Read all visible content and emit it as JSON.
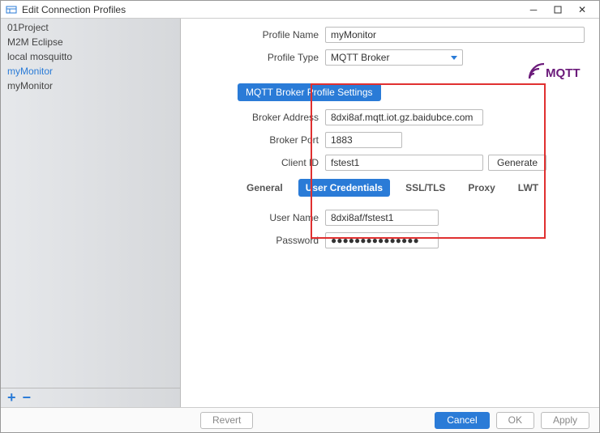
{
  "window": {
    "title": "Edit Connection Profiles"
  },
  "sidebar": {
    "items": [
      {
        "label": "01Project"
      },
      {
        "label": "M2M Eclipse"
      },
      {
        "label": "local mosquitto"
      },
      {
        "label": "myMonitor"
      },
      {
        "label": "myMonitor"
      }
    ],
    "selected_index": 3
  },
  "profile": {
    "name_label": "Profile Name",
    "name_value": "myMonitor",
    "type_label": "Profile Type",
    "type_value": "MQTT Broker"
  },
  "section_header": "MQTT Broker Profile Settings",
  "broker": {
    "address_label": "Broker Address",
    "address_value": "8dxi8af.mqtt.iot.gz.baidubce.com",
    "port_label": "Broker Port",
    "port_value": "1883",
    "clientid_label": "Client ID",
    "clientid_value": "fstest1",
    "generate_label": "Generate"
  },
  "tabs": {
    "items": [
      "General",
      "User Credentials",
      "SSL/TLS",
      "Proxy",
      "LWT"
    ],
    "active_index": 1
  },
  "credentials": {
    "username_label": "User Name",
    "username_value": "8dxi8af/fstest1",
    "password_label": "Password",
    "password_value": "●●●●●●●●●●●●●●●"
  },
  "footer": {
    "revert": "Revert",
    "cancel": "Cancel",
    "ok": "OK",
    "apply": "Apply"
  }
}
